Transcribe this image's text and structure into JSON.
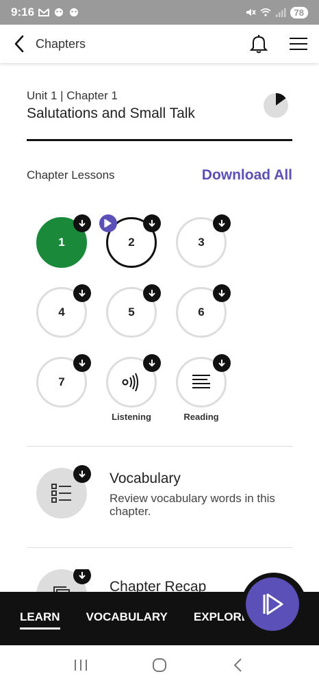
{
  "status_bar": {
    "time": "9:16",
    "battery": "78"
  },
  "header": {
    "title": "Chapters"
  },
  "chapter": {
    "unit_label": "Unit 1 | Chapter 1",
    "title": "Salutations and Small Talk",
    "progress_fraction": 0.15
  },
  "lessons_section": {
    "label": "Chapter Lessons",
    "download_all": "Download All"
  },
  "lessons": [
    {
      "label": "1",
      "state": "done"
    },
    {
      "label": "2",
      "state": "current"
    },
    {
      "label": "3",
      "state": "todo"
    },
    {
      "label": "4",
      "state": "todo"
    },
    {
      "label": "5",
      "state": "todo"
    },
    {
      "label": "6",
      "state": "todo"
    },
    {
      "label": "7",
      "state": "todo"
    },
    {
      "caption": "Listening",
      "icon": "listening-icon",
      "state": "todo"
    },
    {
      "caption": "Reading",
      "icon": "reading-icon",
      "state": "todo"
    }
  ],
  "vocabulary": {
    "title": "Vocabulary",
    "description": "Review vocabulary words in this chapter."
  },
  "recap": {
    "title": "Chapter Recap"
  },
  "bottom_nav": {
    "tabs": [
      "LEARN",
      "VOCABULARY",
      "EXPLORE"
    ],
    "active": "LEARN"
  },
  "colors": {
    "accent": "#5b4fb8",
    "done": "#1a8a3a"
  }
}
